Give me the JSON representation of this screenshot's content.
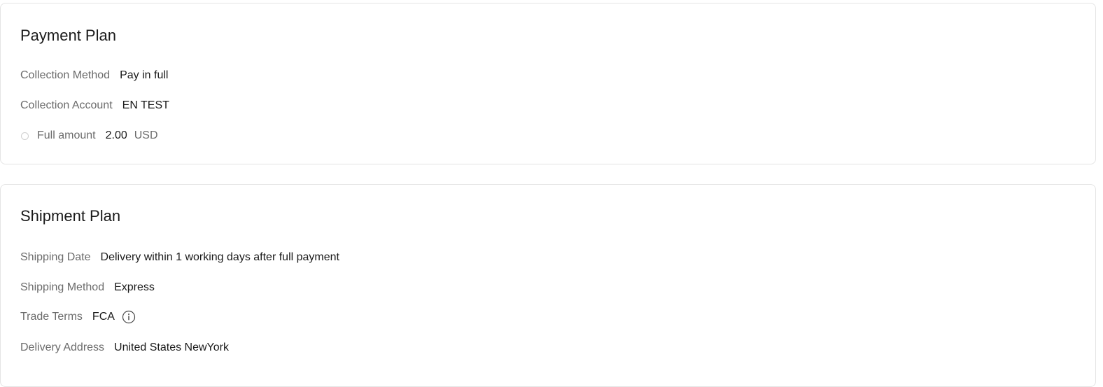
{
  "payment_plan": {
    "title": "Payment Plan",
    "collection_method": {
      "label": "Collection Method",
      "value": "Pay in full"
    },
    "collection_account": {
      "label": "Collection Account",
      "value": "EN TEST"
    },
    "full_amount": {
      "label": "Full amount",
      "value": "2.00",
      "currency": "USD"
    }
  },
  "shipment_plan": {
    "title": "Shipment Plan",
    "shipping_date": {
      "label": "Shipping Date",
      "value": "Delivery within 1 working days after full payment"
    },
    "shipping_method": {
      "label": "Shipping Method",
      "value": "Express"
    },
    "trade_terms": {
      "label": "Trade Terms",
      "value": "FCA",
      "icon": "info-icon"
    },
    "delivery_address": {
      "label": "Delivery Address",
      "value": "United States NewYork"
    }
  }
}
